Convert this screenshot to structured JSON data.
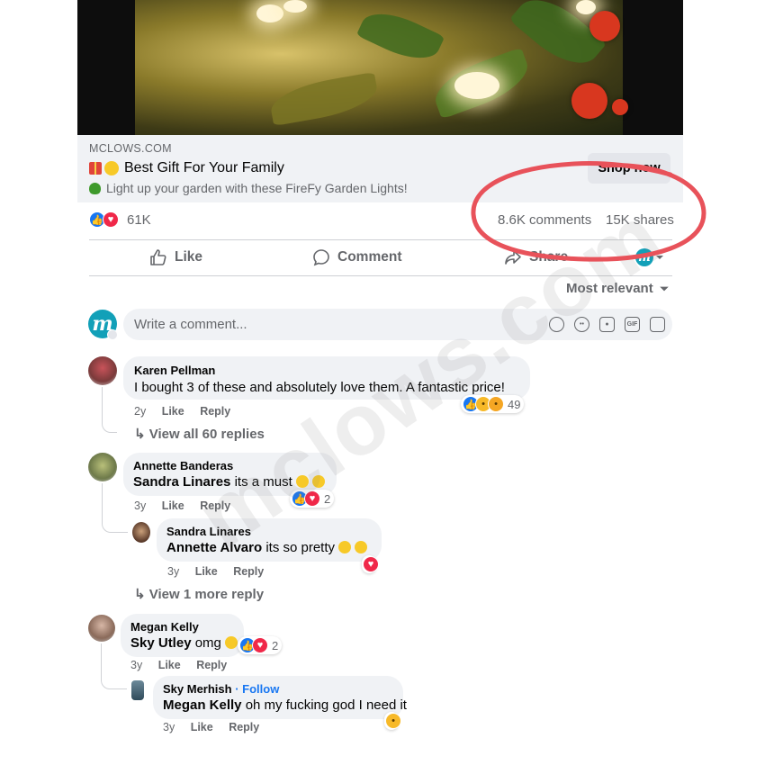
{
  "ad": {
    "site": "MCLOWS.COM",
    "title": "Best Gift For Your Family",
    "description": "Light up your garden with these FireFy Garden Lights!",
    "cta": "Shop now",
    "title_icons": [
      "gift-emoji",
      "smile-emoji"
    ],
    "desc_icon": "tree-emoji"
  },
  "stats": {
    "reactions": "61K",
    "comments": "8.6K comments",
    "shares": "15K shares"
  },
  "actions": {
    "like": "Like",
    "comment": "Comment",
    "share": "Share"
  },
  "sort": {
    "label": "Most relevant"
  },
  "composer": {
    "placeholder": "Write a comment..."
  },
  "comments": [
    {
      "name": "Karen Pellman",
      "text": "I bought 3 of these and absolutely love them. A fantastic price!",
      "time": "2y",
      "like": "Like",
      "reply": "Reply",
      "reaction_count": "49",
      "view_replies": "View all 60 replies"
    },
    {
      "name": "Annette Banderas",
      "mention": "Sandra Linares",
      "text": "its a must",
      "time": "3y",
      "like": "Like",
      "reply": "Reply",
      "reaction_count": "2",
      "reply_comment": {
        "name": "Sandra Linares",
        "mention": "Annette Alvaro",
        "text": "its so pretty",
        "time": "3y",
        "like": "Like",
        "reply": "Reply"
      },
      "view_more": "View 1 more reply"
    },
    {
      "name": "Megan Kelly",
      "mention": "Sky Utley",
      "text": "omg",
      "time": "3y",
      "like": "Like",
      "reply": "Reply",
      "reaction_count": "2",
      "reply_comment": {
        "name": "Sky Merhish",
        "follow": "· Follow",
        "mention": "Megan Kelly",
        "text": "oh my fucking god I need it",
        "time": "3y",
        "like": "Like",
        "reply": "Reply"
      }
    }
  ],
  "watermark": "mclows.com",
  "colors": {
    "facebook_blue": "#1877f2",
    "love_red": "#f02849",
    "annotation_red": "#e8525a",
    "muted_text": "#65676b",
    "bubble_gray": "#f0f2f5"
  }
}
